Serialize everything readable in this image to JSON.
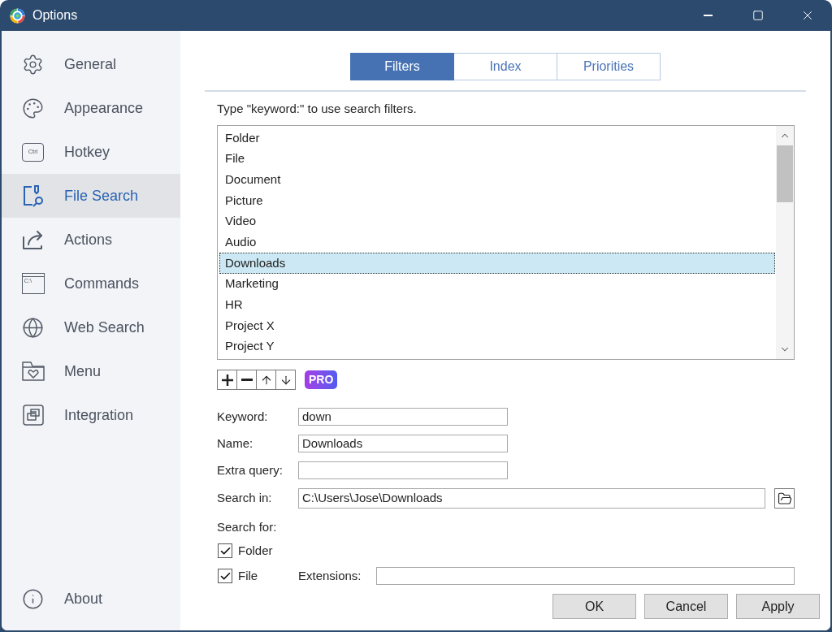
{
  "window": {
    "title": "Options"
  },
  "sidebar": {
    "items": [
      {
        "label": "General",
        "selected": false
      },
      {
        "label": "Appearance",
        "selected": false
      },
      {
        "label": "Hotkey",
        "selected": false,
        "icon_text": "Ctrl"
      },
      {
        "label": "File Search",
        "selected": true
      },
      {
        "label": "Actions",
        "selected": false
      },
      {
        "label": "Commands",
        "selected": false,
        "icon_text": "C:\\"
      },
      {
        "label": "Web Search",
        "selected": false
      },
      {
        "label": "Menu",
        "selected": false
      },
      {
        "label": "Integration",
        "selected": false
      }
    ],
    "footer_items": [
      {
        "label": "About",
        "selected": false
      }
    ]
  },
  "tabs": [
    {
      "label": "Filters",
      "selected": true
    },
    {
      "label": "Index",
      "selected": false
    },
    {
      "label": "Priorities",
      "selected": false
    }
  ],
  "filters": {
    "hint": "Type \"keyword:\" to use search filters.",
    "list": [
      {
        "label": "Folder",
        "selected": false
      },
      {
        "label": "File",
        "selected": false
      },
      {
        "label": "Document",
        "selected": false
      },
      {
        "label": "Picture",
        "selected": false
      },
      {
        "label": "Video",
        "selected": false
      },
      {
        "label": "Audio",
        "selected": false
      },
      {
        "label": "Downloads",
        "selected": true
      },
      {
        "label": "Marketing",
        "selected": false
      },
      {
        "label": "HR",
        "selected": false
      },
      {
        "label": "Project X",
        "selected": false
      },
      {
        "label": "Project Y",
        "selected": false
      }
    ],
    "badge": "PRO"
  },
  "fields": [
    {
      "kind": "text",
      "label": "Keyword:",
      "value": "down"
    },
    {
      "kind": "text",
      "label": "Name:",
      "value": "Downloads"
    },
    {
      "kind": "text",
      "label": "Extra query:"
    },
    {
      "kind": "path",
      "label": "Search in:",
      "value": "C:\\Users\\Jose\\Downloads"
    }
  ],
  "search_for": {
    "label": "Search for:",
    "options": [
      {
        "label": "Folder",
        "checked": true
      },
      {
        "label": "File",
        "checked": true,
        "field": {
          "label": "Extensions:"
        }
      }
    ]
  },
  "buttons": [
    {
      "label": "OK"
    },
    {
      "label": "Cancel"
    },
    {
      "label": "Apply"
    }
  ]
}
